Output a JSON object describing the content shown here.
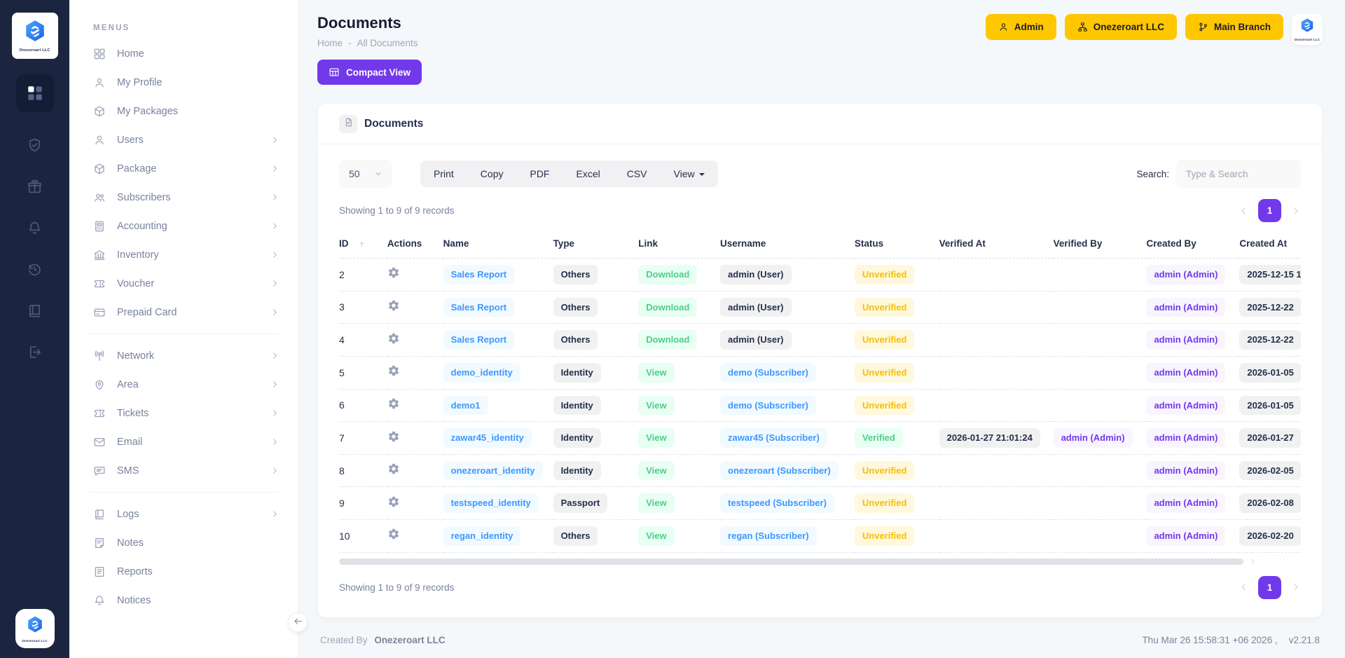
{
  "brand": {
    "name": "Onezeroart LLC"
  },
  "colors": {
    "accent_purple": "#7239ea",
    "brand_yellow": "#ffc700",
    "link_blue": "#3e97ff",
    "success_green": "#50cd89",
    "warning_yellow": "#f6c000",
    "sidebar_dark": "#1c2540"
  },
  "iconbar": {
    "logo_text": "Onezeroart LLC",
    "icons": [
      {
        "name": "dashboard",
        "active": true
      },
      {
        "name": "shield-check",
        "active": false
      },
      {
        "name": "gift",
        "active": false
      },
      {
        "name": "bell",
        "active": false
      },
      {
        "name": "history",
        "active": false
      },
      {
        "name": "ledger",
        "active": false
      },
      {
        "name": "sign-out",
        "active": false
      }
    ]
  },
  "sidebar": {
    "section_label": "MENUS",
    "groups": [
      {
        "items": [
          {
            "label": "Home",
            "icon": "grid",
            "expandable": false
          },
          {
            "label": "My Profile",
            "icon": "user",
            "expandable": false
          },
          {
            "label": "My Packages",
            "icon": "box",
            "expandable": false
          },
          {
            "label": "Users",
            "icon": "user",
            "expandable": true
          },
          {
            "label": "Package",
            "icon": "box",
            "expandable": true
          },
          {
            "label": "Subscribers",
            "icon": "users",
            "expandable": true
          },
          {
            "label": "Accounting",
            "icon": "calculator",
            "expandable": true
          },
          {
            "label": "Inventory",
            "icon": "bank",
            "expandable": true
          },
          {
            "label": "Voucher",
            "icon": "ticket",
            "expandable": true
          },
          {
            "label": "Prepaid Card",
            "icon": "card",
            "expandable": true
          }
        ]
      },
      {
        "items": [
          {
            "label": "Network",
            "icon": "antenna",
            "expandable": true
          },
          {
            "label": "Area",
            "icon": "pin",
            "expandable": true
          },
          {
            "label": "Tickets",
            "icon": "ticket",
            "expandable": true
          },
          {
            "label": "Email",
            "icon": "envelope",
            "expandable": true
          },
          {
            "label": "SMS",
            "icon": "chat",
            "expandable": true
          }
        ]
      },
      {
        "items": [
          {
            "label": "Logs",
            "icon": "book",
            "expandable": true
          },
          {
            "label": "Notes",
            "icon": "note",
            "expandable": false
          },
          {
            "label": "Reports",
            "icon": "report",
            "expandable": false
          },
          {
            "label": "Notices",
            "icon": "bell",
            "expandable": false
          }
        ]
      }
    ]
  },
  "header": {
    "title": "Documents",
    "breadcrumb": {
      "home": "Home",
      "separator": "-",
      "current": "All Documents"
    },
    "buttons": [
      {
        "label": "Admin",
        "icon": "user"
      },
      {
        "label": "Onezeroart LLC",
        "icon": "sitemap"
      },
      {
        "label": "Main Branch",
        "icon": "branch"
      }
    ]
  },
  "toolbar": {
    "compact_view": "Compact View",
    "page_size": "50",
    "export_buttons": [
      "Print",
      "Copy",
      "PDF",
      "Excel",
      "CSV"
    ],
    "view_menu": "View",
    "search_label": "Search:",
    "search_placeholder": "Type & Search"
  },
  "card": {
    "title": "Documents"
  },
  "table": {
    "showing_text": "Showing 1 to 9 of 9 records",
    "current_page": "1",
    "columns": [
      "ID",
      "Actions",
      "Name",
      "Type",
      "Link",
      "Username",
      "Status",
      "Verified At",
      "Verified By",
      "Created By",
      "Created At"
    ],
    "rows": [
      {
        "id": "2",
        "name": "Sales Report",
        "type": "Others",
        "link": "Download",
        "username": "admin (User)",
        "username_variant": "gray",
        "status": "Unverified",
        "verified_at": "",
        "verified_by": "",
        "created_by": "admin (Admin)",
        "created_at": "2025-12-15 1"
      },
      {
        "id": "3",
        "name": "Sales Report",
        "type": "Others",
        "link": "Download",
        "username": "admin (User)",
        "username_variant": "gray",
        "status": "Unverified",
        "verified_at": "",
        "verified_by": "",
        "created_by": "admin (Admin)",
        "created_at": "2025-12-22"
      },
      {
        "id": "4",
        "name": "Sales Report",
        "type": "Others",
        "link": "Download",
        "username": "admin (User)",
        "username_variant": "gray",
        "status": "Unverified",
        "verified_at": "",
        "verified_by": "",
        "created_by": "admin (Admin)",
        "created_at": "2025-12-22"
      },
      {
        "id": "5",
        "name": "demo_identity",
        "type": "Identity",
        "link": "View",
        "username": "demo (Subscriber)",
        "username_variant": "blue",
        "status": "Unverified",
        "verified_at": "",
        "verified_by": "",
        "created_by": "admin (Admin)",
        "created_at": "2026-01-05"
      },
      {
        "id": "6",
        "name": "demo1",
        "type": "Identity",
        "link": "View",
        "username": "demo (Subscriber)",
        "username_variant": "blue",
        "status": "Unverified",
        "verified_at": "",
        "verified_by": "",
        "created_by": "admin (Admin)",
        "created_at": "2026-01-05"
      },
      {
        "id": "7",
        "name": "zawar45_identity",
        "type": "Identity",
        "link": "View",
        "username": "zawar45 (Subscriber)",
        "username_variant": "blue",
        "status": "Verified",
        "verified_at": "2026-01-27 21:01:24",
        "verified_by": "admin (Admin)",
        "created_by": "admin (Admin)",
        "created_at": "2026-01-27"
      },
      {
        "id": "8",
        "name": "onezeroart_identity",
        "type": "Identity",
        "link": "View",
        "username": "onezeroart (Subscriber)",
        "username_variant": "blue",
        "status": "Unverified",
        "verified_at": "",
        "verified_by": "",
        "created_by": "admin (Admin)",
        "created_at": "2026-02-05"
      },
      {
        "id": "9",
        "name": "testspeed_identity",
        "type": "Passport",
        "link": "View",
        "username": "testspeed (Subscriber)",
        "username_variant": "blue",
        "status": "Unverified",
        "verified_at": "",
        "verified_by": "",
        "created_by": "admin (Admin)",
        "created_at": "2026-02-08"
      },
      {
        "id": "10",
        "name": "regan_identity",
        "type": "Others",
        "link": "View",
        "username": "regan (Subscriber)",
        "username_variant": "blue",
        "status": "Unverified",
        "verified_at": "",
        "verified_by": "",
        "created_by": "admin (Admin)",
        "created_at": "2026-02-20"
      }
    ]
  },
  "footer": {
    "created_by_label": "Created By",
    "company": "Onezeroart LLC",
    "datetime": "Thu Mar 26 15:58:31 +06 2026 ,",
    "version": "v2.21.8"
  }
}
